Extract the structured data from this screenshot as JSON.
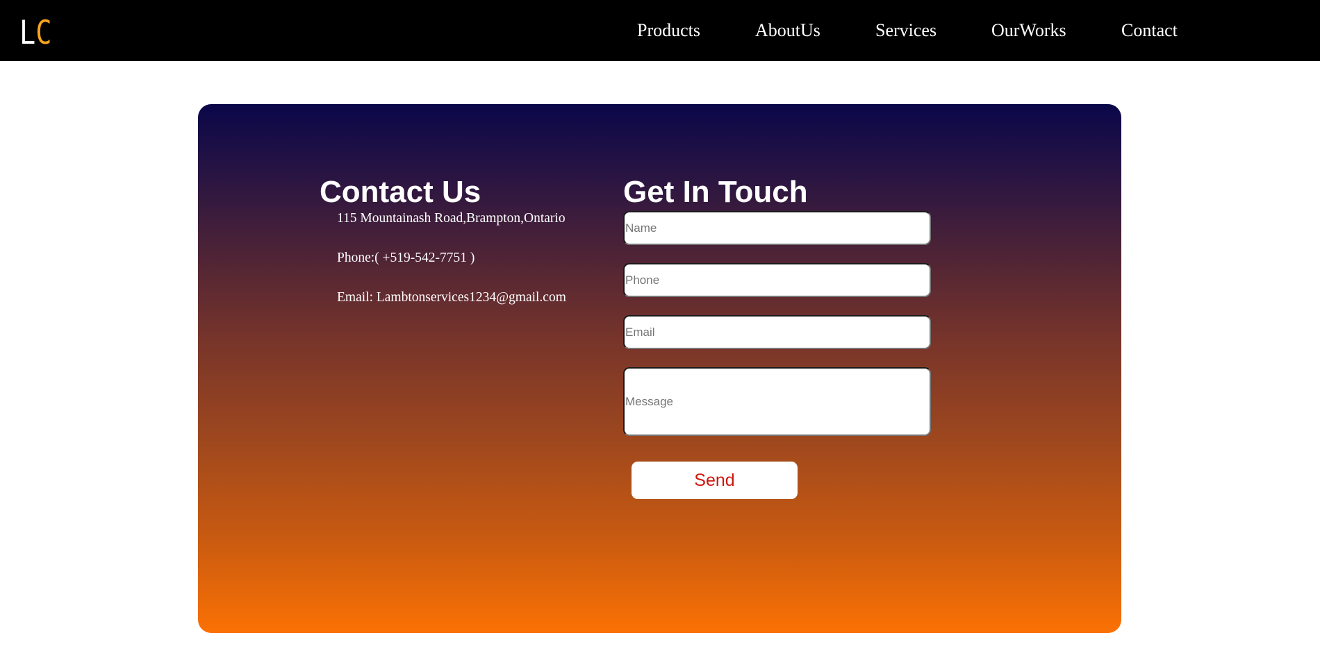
{
  "header": {
    "logo": {
      "first_letter": "L",
      "second_letter": "C"
    },
    "nav": {
      "products": "Products",
      "about": "AboutUs",
      "services": "Services",
      "works": "OurWorks",
      "contact": "Contact"
    }
  },
  "contact": {
    "heading": "Contact Us",
    "address": "115 Mountainash Road,Brampton,Ontario",
    "phone": "Phone:( +519-542-7751 )",
    "email": "Email: Lambtonservices1234@gmail.com"
  },
  "form": {
    "heading": "Get In Touch",
    "name_placeholder": "Name",
    "phone_placeholder": "Phone",
    "email_placeholder": "Email",
    "message_placeholder": "Message",
    "send_label": "Send"
  },
  "colors": {
    "header_background": "#000000",
    "logo_accent": "#f7a41d",
    "card_gradient_top": "#0a0749",
    "card_gradient_bottom": "#fb7104",
    "send_text": "#d0150f"
  }
}
